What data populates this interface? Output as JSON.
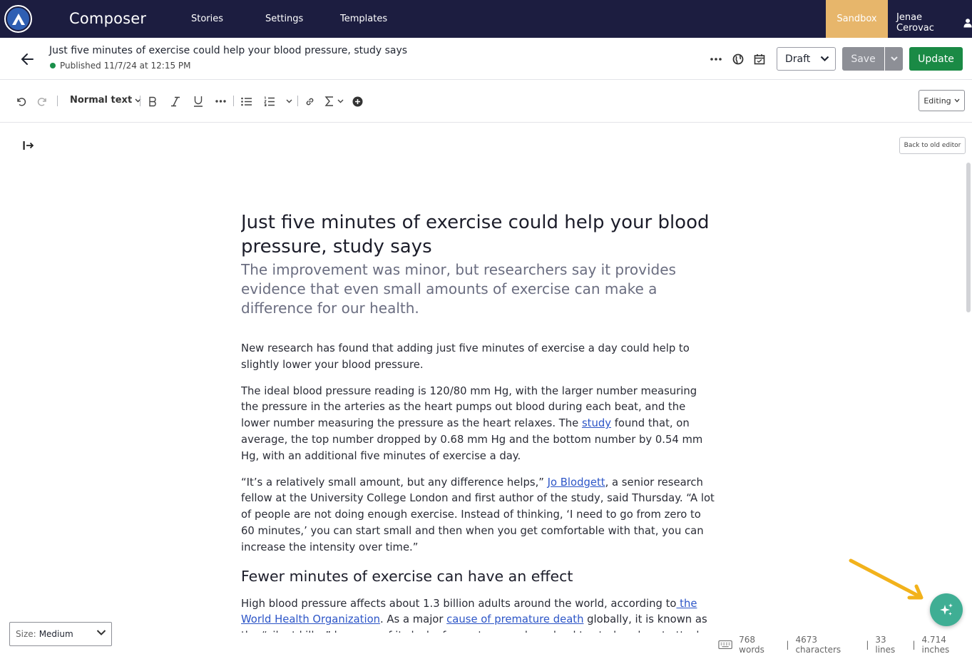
{
  "nav": {
    "brand": "Composer",
    "links": [
      "Stories",
      "Settings",
      "Templates"
    ],
    "sandbox": "Sandbox",
    "user": "Jenae Cerovac"
  },
  "header": {
    "title": "Just five minutes of exercise could help your blood pressure, study says",
    "status": "Published 11/7/24 at 12:15 PM",
    "draft_label": "Draft",
    "save_label": "Save",
    "update_label": "Update",
    "status_color": "#1a8f4a"
  },
  "toolbar": {
    "text_style": "Normal text",
    "mode": "Editing",
    "icons": [
      "undo-icon",
      "redo-icon",
      "bold-icon",
      "italic-icon",
      "underline-icon",
      "more-icon",
      "bullet-list-icon",
      "numbered-list-icon",
      "chevron-down-icon",
      "link-icon",
      "sigma-icon",
      "add-circle-icon"
    ]
  },
  "back_to_old": "Back to old editor",
  "article": {
    "headline": "Just five minutes of exercise could help your blood pressure, study says",
    "dek": "The improvement was minor, but researchers say it provides evidence that even small amounts of exercise can make a difference for our health.",
    "p1": "New research has found that adding just five minutes of exercise a day could help to slightly lower your blood pressure.",
    "p2_a": "The ideal blood pressure reading is 120/80 mm Hg, with the larger number measuring the pressure in the arteries as the heart pumps out blood during each beat, and the lower number measuring the pressure as the heart relaxes. The ",
    "p2_link": "study",
    "p2_b": " found that, on average, the top number dropped by 0.68 mm Hg and the bottom number by 0.54 mm Hg, with an additional five minutes of exercise a day.",
    "p3_a": "“It’s a relatively small amount, but any difference helps,” ",
    "p3_link": "Jo Blodgett",
    "p3_b": ", a senior research fellow at the University College London and first author of the study, said Thursday. “A lot of people are not doing enough exercise. Instead of thinking, ‘I need to go from zero to 60 minutes,’ you can start small and then when you get comfortable with that, you can increase the intensity over time.”",
    "subhead": "Fewer minutes of exercise can have an effect",
    "p4_a": "High blood pressure affects about 1.3 billion adults around the world, according to",
    "p4_link1": " the World Health Organization",
    "p4_b": ". As a major ",
    "p4_link2": "cause of premature death",
    "p4_c": " globally, it is known as the “silent killer” because of its lack of symptoms and can lead to strokes, heart attacks and kidney disease."
  },
  "footer": {
    "size_label": "Size:",
    "size_value": "Medium",
    "words": "768 words",
    "characters": "4673 characters",
    "lines": "33 lines",
    "inches": "4.714 inches",
    "divider": "|"
  },
  "colors": {
    "nav_bg": "#1c1d40",
    "sandbox": "#e7b66b",
    "update": "#1a8a45",
    "fab": "#3fae94",
    "arrow": "#f2b21b",
    "link": "#2c55c7"
  }
}
